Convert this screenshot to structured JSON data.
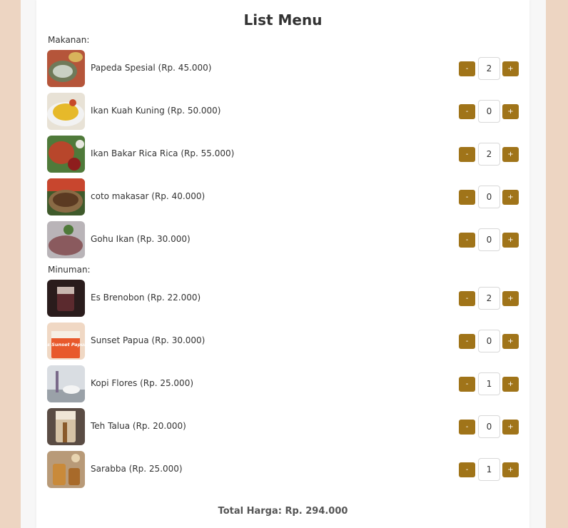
{
  "title": "List Menu",
  "sections": [
    {
      "label": "Makanan:",
      "items": [
        {
          "label": "Papeda Spesial (Rp. 45.000)",
          "qty": "2"
        },
        {
          "label": "Ikan Kuah Kuning (Rp. 50.000)",
          "qty": "0"
        },
        {
          "label": "Ikan Bakar Rica Rica (Rp. 55.000)",
          "qty": "2"
        },
        {
          "label": "coto makasar (Rp. 40.000)",
          "qty": "0"
        },
        {
          "label": "Gohu Ikan (Rp. 30.000)",
          "qty": "0"
        }
      ]
    },
    {
      "label": "Minuman:",
      "items": [
        {
          "label": "Es Brenobon (Rp. 22.000)",
          "qty": "2"
        },
        {
          "label": "Sunset Papua (Rp. 30.000)",
          "qty": "0",
          "image_text": "Es Sunset Papua"
        },
        {
          "label": "Kopi Flores (Rp. 25.000)",
          "qty": "1"
        },
        {
          "label": "Teh Talua (Rp. 20.000)",
          "qty": "0"
        },
        {
          "label": "Sarabba (Rp. 25.000)",
          "qty": "1"
        }
      ]
    }
  ],
  "buttons": {
    "minus": "-",
    "plus": "+"
  },
  "total": "Total Harga: Rp. 294.000",
  "colors": {
    "page_bg": "#edd5c2",
    "button": "#a07419",
    "card": "#ffffff"
  }
}
